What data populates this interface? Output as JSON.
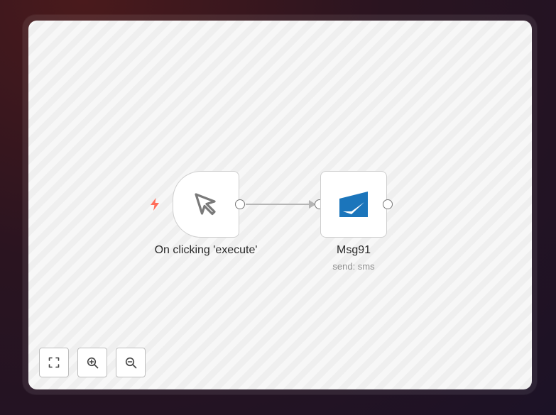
{
  "workflow": {
    "nodes": [
      {
        "id": "trigger",
        "label": "On clicking 'execute'",
        "icon": "cursor-arrow-icon"
      },
      {
        "id": "msg91",
        "label": "Msg91",
        "subtitle": "send: sms",
        "icon": "msg91-logo-icon"
      }
    ]
  },
  "controls": {
    "icons": [
      "fit-view-icon",
      "zoom-in-icon",
      "zoom-out-icon"
    ]
  },
  "colors": {
    "trigger_bolt": "#ff6d5a",
    "msg91_brand": "#1b75bb",
    "connector": "#b5b5b5"
  }
}
